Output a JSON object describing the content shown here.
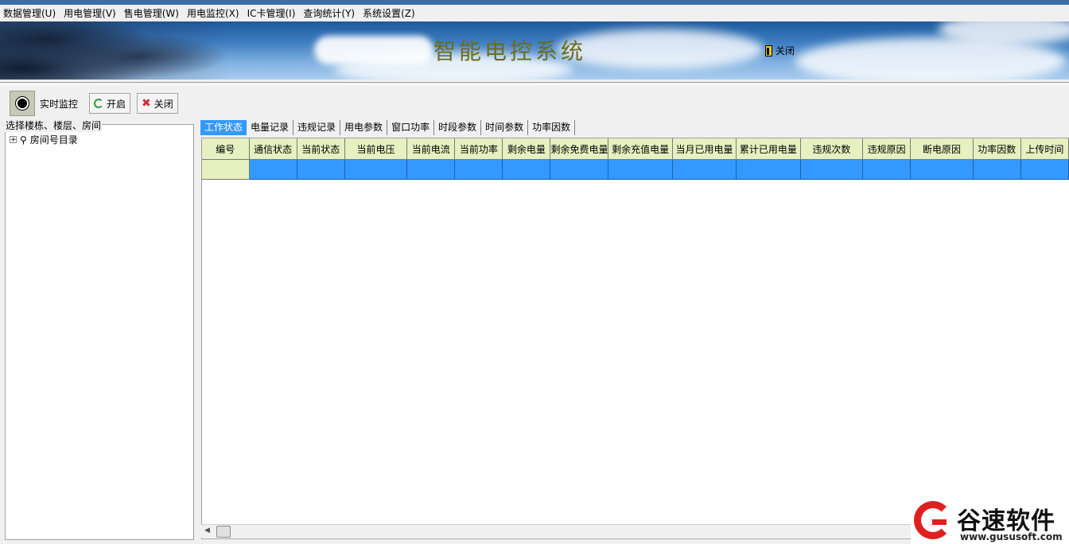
{
  "menu": [
    "数据管理(U)",
    "用电管理(V)",
    "售电管理(W)",
    "用电监控(X)",
    "IC卡管理(I)",
    "查询统计(Y)",
    "系统设置(Z)"
  ],
  "banner": {
    "title": "智能电控系统",
    "close_label": "关闭"
  },
  "toolbar": {
    "monitor_label": "实时监控",
    "start_label": "开启",
    "close_label": "关闭"
  },
  "left_panel": {
    "legend": "选择楼栋、楼层、房间",
    "root_node": "房间号目录"
  },
  "tabs": [
    "工作状态",
    "电量记录",
    "违规记录",
    "用电参数",
    "窗口功率",
    "时段参数",
    "时间参数",
    "功率因数"
  ],
  "grid": {
    "columns": [
      "编号",
      "通信状态",
      "当前状态",
      "当前电压",
      "当前电流",
      "当前功率",
      "剩余电量",
      "剩余免费电量",
      "剩余充值电量",
      "当月已用电量",
      "累计已用电量",
      "违规次数",
      "违规原因",
      "断电原因",
      "功率因数",
      "上传时间"
    ]
  },
  "watermark": {
    "name": "谷速软件",
    "url": "www.gususoft.com"
  },
  "colors": {
    "selected_row": "#3399ff",
    "header_bg": "#e6f0c0",
    "title_color": "#6b6b1e"
  }
}
